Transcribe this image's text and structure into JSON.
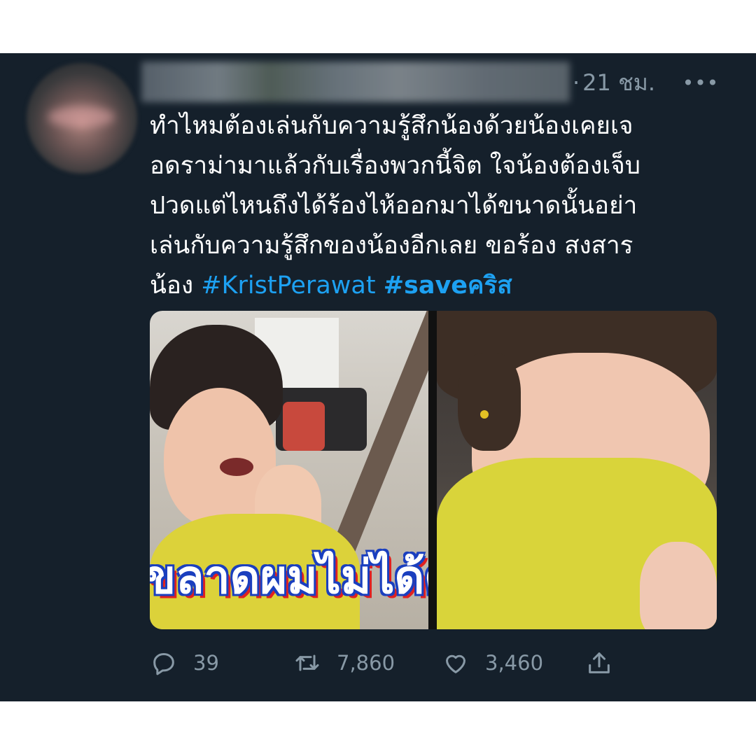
{
  "tweet": {
    "time": "21 ชม.",
    "time_separator": "·",
    "more": "•••",
    "text_lines": [
      "ทำไหมต้องเล่นกับความรู้สึกน้องด้วยน้องเคยเจ",
      "อดราม่ามาแล้วกับเรื่องพวกนี้จิต ใจน้องต้องเจ็บ",
      "ปวดแต่ไหนถึงได้ร้องไห้ออกมาได้ขนาดนั้นอย่า",
      "เล่นกับความรู้สึกของน้องอีกเลย ขอร้อง สงสาร"
    ],
    "last_line_text": "น้อง",
    "hashtags": [
      "#KristPerawat",
      "#saveคริส"
    ],
    "media_caption": "ขลาดผมไม่ได้ด",
    "actions": {
      "reply_count": "39",
      "retweet_count": "7,860",
      "like_count": "3,460"
    }
  },
  "colors": {
    "background": "#15202b",
    "text": "#ffffff",
    "secondary": "#8899a6",
    "accent": "#1da1f2"
  },
  "icons": [
    "reply-icon",
    "retweet-icon",
    "like-icon",
    "share-icon",
    "more-icon"
  ]
}
